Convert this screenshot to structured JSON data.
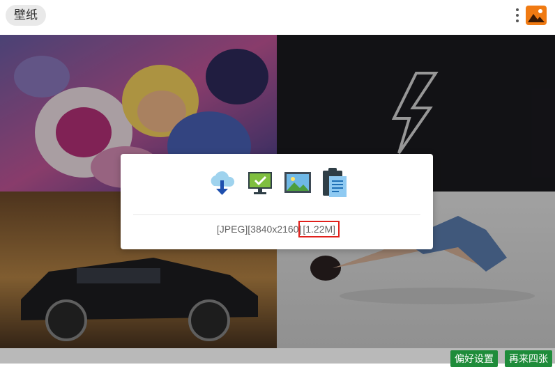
{
  "header": {
    "title": "壁纸",
    "menu_icon": "kebab-menu-icon",
    "app_icon": "image-app-icon"
  },
  "wallpapers": [
    {
      "name": "wallpaper-anime-characters",
      "desc": "cartoon characters"
    },
    {
      "name": "wallpaper-dark-logo",
      "desc": "dark logo"
    },
    {
      "name": "wallpaper-car",
      "desc": "car"
    },
    {
      "name": "wallpaper-person-on-floor",
      "desc": "person lying on floor"
    }
  ],
  "dialog": {
    "actions": [
      {
        "name": "download-icon",
        "kind": "cloud-download"
      },
      {
        "name": "set-desktop-icon",
        "kind": "monitor-check"
      },
      {
        "name": "preview-image-icon",
        "kind": "picture"
      },
      {
        "name": "copy-link-icon",
        "kind": "clipboard"
      }
    ],
    "format": "[JPEG]",
    "resolution": "[3840x2160]",
    "filesize": "[1.22M]"
  },
  "footer": {
    "preferences_label": "偏好设置",
    "refresh_label": "再来四张"
  },
  "colors": {
    "accent_green": "#1e8c3a",
    "highlight_red": "#e0201b"
  }
}
